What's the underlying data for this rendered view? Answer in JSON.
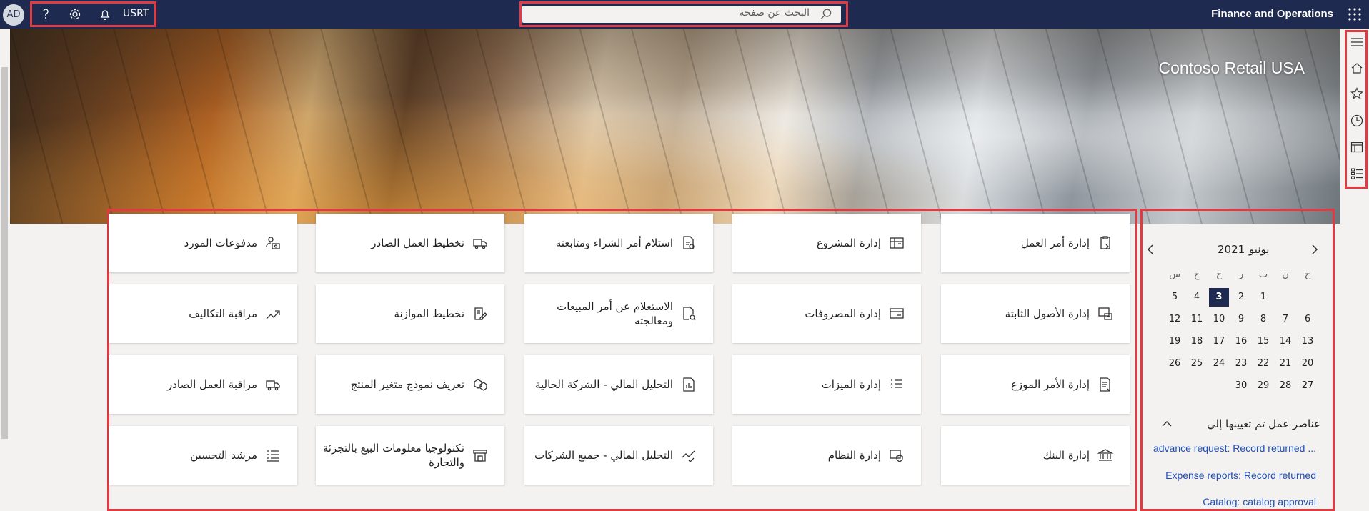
{
  "header": {
    "avatar_initials": "AD",
    "company_code": "USRT",
    "search_placeholder": "البحث عن صفحة",
    "app_title": "Finance and Operations",
    "background_color": "#1e2a4f"
  },
  "hero": {
    "company_name": "Contoso Retail USA"
  },
  "nav_rail": [
    "hamburger-icon",
    "home-icon",
    "star-icon",
    "clock-icon",
    "workspace-icon",
    "modules-icon"
  ],
  "tiles": [
    [
      {
        "label": "إدارة أمر العمل",
        "icon": "clipboard-icon"
      },
      {
        "label": "إدارة المشروع",
        "icon": "project-icon"
      },
      {
        "label": "استلام أمر الشراء ومتابعته",
        "icon": "doc-refresh-icon"
      },
      {
        "label": "تخطيط العمل الصادر",
        "icon": "truck-icon"
      },
      {
        "label": "مدفوعات المورد",
        "icon": "user-money-icon"
      }
    ],
    [
      {
        "label": "إدارة الأصول الثابتة",
        "icon": "asset-icon"
      },
      {
        "label": "إدارة المصروفات",
        "icon": "card-icon"
      },
      {
        "label": "الاستعلام عن أمر المبيعات ومعالجته",
        "icon": "doc-search-icon"
      },
      {
        "label": "تخطيط الموازنة",
        "icon": "doc-pen-icon"
      },
      {
        "label": "مراقبة التكاليف",
        "icon": "trend-icon"
      }
    ],
    [
      {
        "label": "إدارة الأمر الموزع",
        "icon": "doc-list-icon"
      },
      {
        "label": "إدارة الميزات",
        "icon": "list-icon"
      },
      {
        "label": "التحليل المالي - الشركة الحالية",
        "icon": "chart-icon"
      },
      {
        "label": "تعريف نموذج متغير المنتج",
        "icon": "boxes-icon"
      },
      {
        "label": "مراقبة العمل الصادر",
        "icon": "truck-icon"
      }
    ],
    [
      {
        "label": "إدارة البنك",
        "icon": "bank-icon"
      },
      {
        "label": "إدارة النظام",
        "icon": "shield-icon"
      },
      {
        "label": "التحليل المالي - جميع الشركات",
        "icon": "trend-check-icon"
      },
      {
        "label": "تكنولوجيا معلومات البيع بالتجزئة والتجارة",
        "icon": "store-icon"
      },
      {
        "label": "مرشد التحسين",
        "icon": "checklist-icon"
      }
    ]
  ],
  "calendar": {
    "month": "يونيو",
    "year": "2021",
    "weekdays": [
      "ح",
      "ن",
      "ث",
      "ر",
      "خ",
      "ج",
      "س"
    ],
    "weeks": [
      [
        "",
        "",
        "1",
        "2",
        "3",
        "4",
        "5"
      ],
      [
        "6",
        "7",
        "8",
        "9",
        "10",
        "11",
        "12"
      ],
      [
        "13",
        "14",
        "15",
        "16",
        "17",
        "18",
        "19"
      ],
      [
        "20",
        "21",
        "22",
        "23",
        "24",
        "25",
        "26"
      ],
      [
        "27",
        "28",
        "29",
        "30",
        "",
        "",
        ""
      ]
    ],
    "today": "3"
  },
  "work_items": {
    "title": "عناصر عمل تم تعيينها إلي",
    "items": [
      "advance request: Record returned ...",
      "Expense reports: Record returned",
      "Catalog: catalog approval"
    ]
  }
}
